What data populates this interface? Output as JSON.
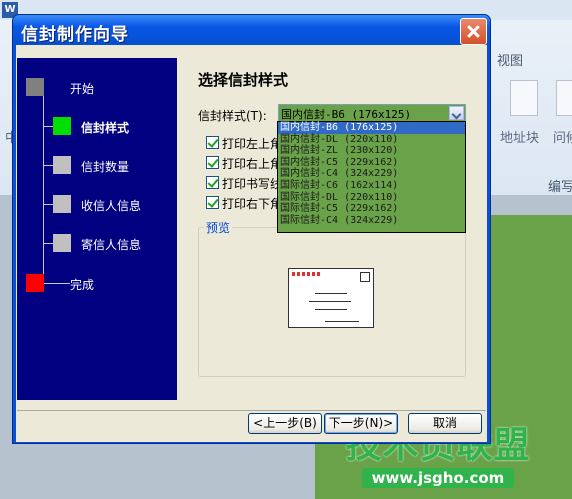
{
  "background_app": {
    "app_icon_letter": "W",
    "ribbon_tab_view": "视图",
    "ribbon_label_address_block": "地址块",
    "ribbon_label_greeting": "问候",
    "ribbon_group_write": "编写",
    "left_char": "中",
    "watermark_title": "技术员联盟",
    "watermark_url": "www.jsgho.com"
  },
  "dialog": {
    "title": "信封制作向导",
    "steps": [
      {
        "label": "开始",
        "color": "#808080"
      },
      {
        "label": "信封样式",
        "color": "#00e000"
      },
      {
        "label": "信封数量",
        "color": "#c0c0c0"
      },
      {
        "label": "收信人信息",
        "color": "#c0c0c0"
      },
      {
        "label": "寄信人信息",
        "color": "#c0c0c0"
      },
      {
        "label": "完成",
        "color": "#ff0000"
      }
    ],
    "page_heading": "选择信封样式",
    "style_label": "信封样式(T):",
    "style_value": "国内信封-B6 (176x125)",
    "checkboxes": [
      {
        "label": "打印左上角",
        "checked": true
      },
      {
        "label": "打印右上角",
        "checked": true
      },
      {
        "label": "打印书写线",
        "checked": true
      },
      {
        "label": "打印右下角",
        "checked": true
      }
    ],
    "preview_label": "预览",
    "buttons": {
      "back": "<上一步(B)",
      "next": "下一步(N)>",
      "cancel": "取消"
    },
    "dropdown_options": [
      "国内信封-B6 (176x125)",
      "国内信封-DL (220x110)",
      "国内信封-ZL (230x120)",
      "国内信封-C5 (229x162)",
      "国内信封-C4 (324x229)",
      "国际信封-C6 (162x114)",
      "国际信封-DL (220x110)",
      "国际信封-C5 (229x162)",
      "国际信封-C4 (324x229)"
    ],
    "dropdown_selected_index": 0
  },
  "colors": {
    "dialog_frame": "#0a4fd8",
    "sidebar": "#000080",
    "dropdown_bg": "#6aa24a",
    "selection": "#316ac5",
    "watermark": "#2fb34a"
  }
}
